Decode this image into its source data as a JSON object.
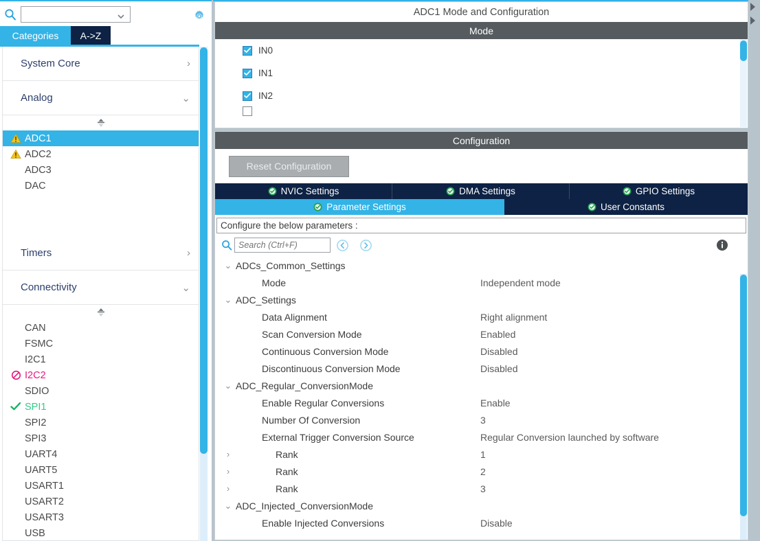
{
  "sidebar": {
    "search": {
      "value": "",
      "placeholder": ""
    },
    "gear_icon": "gear-icon",
    "tabs": [
      {
        "label": "Categories",
        "active": true
      },
      {
        "label": "A->Z",
        "active": false
      }
    ],
    "groups": [
      {
        "label": "System Core",
        "expanded": false
      },
      {
        "label": "Analog",
        "expanded": true
      },
      {
        "label": "Timers",
        "expanded": false
      },
      {
        "label": "Connectivity",
        "expanded": true
      }
    ],
    "analog_items": [
      {
        "label": "ADC1",
        "status": "warning",
        "selected": true
      },
      {
        "label": "ADC2",
        "status": "warning",
        "selected": false
      },
      {
        "label": "ADC3",
        "status": "none",
        "selected": false
      },
      {
        "label": "DAC",
        "status": "none",
        "selected": false
      }
    ],
    "connectivity_items": [
      {
        "label": "CAN",
        "status": "none"
      },
      {
        "label": "FSMC",
        "status": "none"
      },
      {
        "label": "I2C1",
        "status": "none"
      },
      {
        "label": "I2C2",
        "status": "blocked"
      },
      {
        "label": "SDIO",
        "status": "none"
      },
      {
        "label": "SPI1",
        "status": "ok"
      },
      {
        "label": "SPI2",
        "status": "none"
      },
      {
        "label": "SPI3",
        "status": "none"
      },
      {
        "label": "UART4",
        "status": "none"
      },
      {
        "label": "UART5",
        "status": "none"
      },
      {
        "label": "USART1",
        "status": "none"
      },
      {
        "label": "USART2",
        "status": "none"
      },
      {
        "label": "USART3",
        "status": "none"
      },
      {
        "label": "USB",
        "status": "none"
      }
    ]
  },
  "main": {
    "title": "ADC1 Mode and Configuration",
    "mode_band": "Mode",
    "mode_channels": [
      {
        "label": "IN0",
        "checked": true
      },
      {
        "label": "IN1",
        "checked": true
      },
      {
        "label": "IN2",
        "checked": true
      },
      {
        "label": "",
        "checked": false
      }
    ],
    "configuration_band": "Configuration",
    "reset_button": "Reset Configuration",
    "tabs_row1": [
      {
        "label": "NVIC Settings",
        "active": false
      },
      {
        "label": "DMA Settings",
        "active": false
      },
      {
        "label": "GPIO Settings",
        "active": false
      }
    ],
    "tabs_row2": [
      {
        "label": "Parameter Settings",
        "active": true
      },
      {
        "label": "User Constants",
        "active": false
      }
    ],
    "hint": "Configure the below parameters :",
    "search": {
      "value": "",
      "placeholder": "Search (Ctrl+F)"
    },
    "nav_prev_icon": "chevron-left-circle-icon",
    "nav_next_icon": "chevron-right-circle-icon",
    "info_icon": "info-icon",
    "tree": [
      {
        "type": "group",
        "twist": "down",
        "name": "ADCs_Common_Settings",
        "value": ""
      },
      {
        "type": "leaf",
        "twist": "",
        "name": "Mode",
        "value": "Independent mode"
      },
      {
        "type": "group",
        "twist": "down",
        "name": "ADC_Settings",
        "value": ""
      },
      {
        "type": "leaf",
        "twist": "",
        "name": "Data Alignment",
        "value": "Right alignment"
      },
      {
        "type": "leaf",
        "twist": "",
        "name": "Scan Conversion Mode",
        "value": "Enabled"
      },
      {
        "type": "leaf",
        "twist": "",
        "name": "Continuous Conversion Mode",
        "value": "Disabled"
      },
      {
        "type": "leaf",
        "twist": "",
        "name": "Discontinuous Conversion Mode",
        "value": "Disabled"
      },
      {
        "type": "group",
        "twist": "down",
        "name": "ADC_Regular_ConversionMode",
        "value": ""
      },
      {
        "type": "leaf",
        "twist": "",
        "name": "Enable Regular Conversions",
        "value": "Enable"
      },
      {
        "type": "leaf",
        "twist": "",
        "name": "Number Of Conversion",
        "value": "3"
      },
      {
        "type": "leaf",
        "twist": "",
        "name": "External Trigger Conversion Source",
        "value": "Regular Conversion launched by software"
      },
      {
        "type": "rank",
        "twist": "right",
        "name": "Rank",
        "value": "1"
      },
      {
        "type": "rank",
        "twist": "right",
        "name": "Rank",
        "value": "2"
      },
      {
        "type": "rank",
        "twist": "right",
        "name": "Rank",
        "value": "3"
      },
      {
        "type": "group",
        "twist": "down",
        "name": "ADC_Injected_ConversionMode",
        "value": ""
      },
      {
        "type": "leaf",
        "twist": "",
        "name": "Enable Injected Conversions",
        "value": "Disable"
      }
    ]
  },
  "colors": {
    "accent_blue": "#33b3e6",
    "dark_navy": "#0d2244",
    "band_gray": "#555b5e",
    "warning_yellow": "#f5c518",
    "ok_green": "#33cc88",
    "blocked_pink": "#e6197f"
  }
}
